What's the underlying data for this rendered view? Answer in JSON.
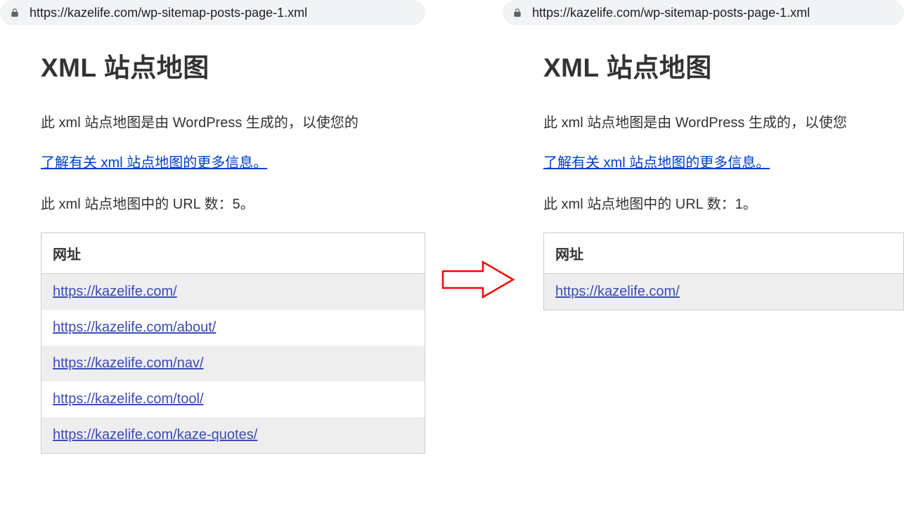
{
  "left": {
    "url_text": "https://kazelife.com/wp-sitemap-posts-page-1.xml",
    "heading": "XML 站点地图",
    "description": "此 xml 站点地图是由 WordPress 生成的，以使您的",
    "learn_more": "了解有关 xml 站点地图的更多信息。",
    "count_text": "此 xml 站点地图中的 URL 数：5。",
    "table_header": "网址",
    "urls": [
      "https://kazelife.com/",
      "https://kazelife.com/about/",
      "https://kazelife.com/nav/",
      "https://kazelife.com/tool/",
      "https://kazelife.com/kaze-quotes/"
    ]
  },
  "right": {
    "url_text": "https://kazelife.com/wp-sitemap-posts-page-1.xml",
    "heading": "XML 站点地图",
    "description": "此 xml 站点地图是由 WordPress 生成的，以使您",
    "learn_more": "了解有关 xml 站点地图的更多信息。",
    "count_text": "此 xml 站点地图中的 URL 数：1。",
    "table_header": "网址",
    "urls": [
      "https://kazelife.com/"
    ]
  },
  "arrow_color": "#ff0000"
}
